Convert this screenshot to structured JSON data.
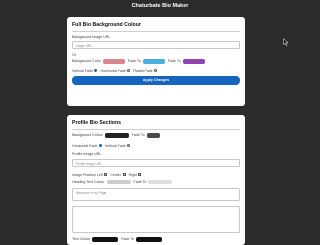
{
  "app": {
    "title": "Chaturbate Bio Maker"
  },
  "background_card": {
    "title": "Full Bio Background Colour",
    "image_label": "Background Image URL",
    "image_placeholder": "Image URL",
    "or_label": "Or",
    "bg_color_label": "Background Color",
    "fade_to_label_1": "Fade To",
    "fade_to_label_2": "Fade To",
    "swatch_colors": [
      "#d9848f",
      "#4ab0d9",
      "#8e44ad"
    ],
    "vertical_fade": "Vertical Fade",
    "horizontal_fade": "Horizontal Fade",
    "radial_fade": "Radial Fade",
    "apply_button": "Apply Changes"
  },
  "profile_card": {
    "title": "Profile Bio Sections",
    "bg_color_label": "Background Colour",
    "fade_to_label": "Fade To",
    "swatch_colors": [
      "#222222",
      "#4a4a4a"
    ],
    "horizontal_fade": "Horizontal Fade",
    "vertical_fade": "Vertical Fade",
    "profile_image_label": "Profile Image URL",
    "profile_image_placeholder": "Profile image URL",
    "image_position_label": "Image Position Left",
    "center_label": "Center",
    "right_label": "Right",
    "heading_text_label": "Heading Text Colour",
    "heading_fade_label": "Fade To",
    "heading_swatch_colors": [
      "#cccccc",
      "#dddddd"
    ],
    "welcome_placeholder": "Welcome to my Page",
    "text_colour_label": "Text Colour",
    "text_fade_label": "Fade To",
    "text_swatch_colors": [
      "#111111",
      "#111111"
    ]
  }
}
